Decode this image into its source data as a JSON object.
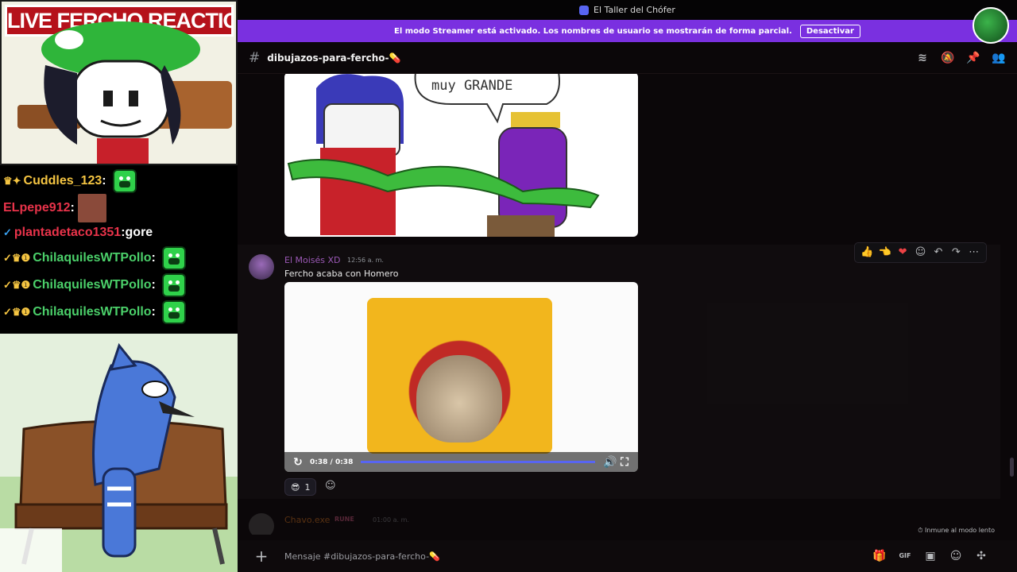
{
  "stream": {
    "banner": "LIVE FERCHO REACTION",
    "chat": [
      {
        "badges": "♛✦",
        "user": "Cuddles_123",
        "color": "#f5c542",
        "message": "",
        "emote": "pepe-emote"
      },
      {
        "badges": "",
        "user": "ELpepe912",
        "color": "#e8334a",
        "message": "",
        "emote": "face-emote"
      },
      {
        "badges": "✓",
        "user": "plantadetaco1351",
        "color": "#e8334a",
        "message": " gore",
        "emote": ""
      },
      {
        "badges": "✓♛❶",
        "user": "ChilaquilesWTPollo",
        "color": "#4bd06a",
        "message": "",
        "emote": "pepe-emote"
      },
      {
        "badges": "✓♛❶",
        "user": "ChilaquilesWTPollo",
        "color": "#4bd06a",
        "message": "",
        "emote": "pepe-emote"
      },
      {
        "badges": "✓♛❶",
        "user": "ChilaquilesWTPollo",
        "color": "#4bd06a",
        "message": "",
        "emote": "pepe-emote"
      }
    ]
  },
  "window": {
    "title": "El Taller del Chófer"
  },
  "streamer_banner": {
    "text": "El modo Streamer está activado. Los nombres de usuario se mostrarán de forma parcial.",
    "button": "Desactivar"
  },
  "channel": {
    "name": "dibujazos-para-fercho-💊"
  },
  "image1": {
    "bubble_text": "muy GRANDE"
  },
  "message": {
    "author": "El Moisés XD",
    "time": "12:56 a. m.",
    "text": "Fercho acaba con Homero",
    "author_color": "#9b59b6"
  },
  "video": {
    "time": "0:38 / 0:38",
    "progress_fraction": 1.0
  },
  "reaction": {
    "emoji": "😎",
    "count": "1"
  },
  "next_message": {
    "author": "Chavo.exe",
    "badge": "RUNE",
    "time": "01:00 a. m."
  },
  "slowmode_text": "Inmune al modo lento",
  "composer": {
    "placeholder": "Mensaje #dibujazos-para-fercho-💊"
  },
  "colors": {
    "accent": "#5865f2",
    "streamer_bar": "#7a30e0",
    "banner_red": "#b5121b"
  }
}
